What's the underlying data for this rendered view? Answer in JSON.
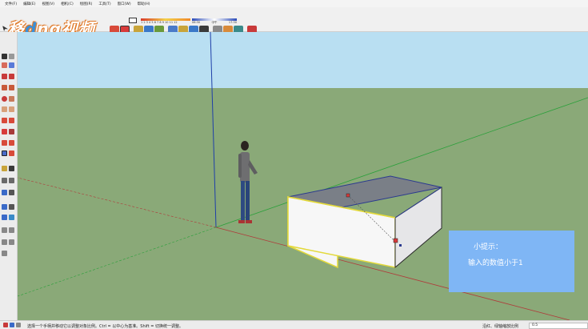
{
  "menu": {
    "items": [
      "文件(F)",
      "编辑(E)",
      "视图(V)",
      "相机(C)",
      "绘图(R)",
      "工具(T)",
      "窗口(W)",
      "帮助(H)"
    ]
  },
  "brand": {
    "text_left": "移",
    "text_o": "d",
    "text_right": "ng视频",
    "full": "移dng视频"
  },
  "shadow_controls": {
    "month_ticks": "1 2 3 4 5 6 7 8 9 10 11 12",
    "time_start": "06:30",
    "time_mid": "中午",
    "time_end": "17:30"
  },
  "tip": {
    "title": "小提示：",
    "body": "输入的数值小于1"
  },
  "status": {
    "hint": "选择一个手柄并移动它以调整对象比例。Ctrl = 以中心为基准。Shift = 切换统一调整。",
    "measure_label": "比例",
    "measure_hint": "沿红、绿轴缩放比例",
    "measure_value": "0.5"
  },
  "colors": {
    "sky": "#b9dff2",
    "ground": "#8aa978",
    "tip_bg": "#7fb6f5",
    "selection": "#f0e030"
  },
  "icons": {
    "toolbar": [
      "select-icon",
      "eraser-icon",
      "paint-icon",
      "rotate-icon",
      "move-icon",
      "pushpull-icon",
      "offset-icon",
      "followme-icon",
      "scale-icon",
      "tape-icon",
      "protractor-icon",
      "axes-icon",
      "text-icon",
      "dimension-icon",
      "orbit-icon",
      "pan-icon",
      "zoom-icon",
      "zoom-extents-icon",
      "section-icon",
      "components-icon",
      "materials-icon",
      "warehouse-icon",
      "extension-icon"
    ],
    "left": [
      "select-icon",
      "component-icon",
      "eraser-icon",
      "paint-icon",
      "line-icon",
      "freehand-icon",
      "rectangle-icon",
      "rotated-rect-icon",
      "circle-icon",
      "polygon-icon",
      "arc-icon",
      "pie-icon",
      "pushpull-icon",
      "followme-icon",
      "move-icon",
      "rotate-icon",
      "scale-icon",
      "offset-icon",
      "tape-icon",
      "dimension-icon",
      "protractor-icon",
      "text-icon",
      "axes-icon",
      "3dtext-icon",
      "orbit-icon",
      "pan-icon",
      "zoom-icon",
      "zoom-window-icon",
      "zoom-extents-icon",
      "previous-icon",
      "position-camera-icon",
      "walk-icon",
      "look-around-icon",
      "section-icon"
    ]
  }
}
